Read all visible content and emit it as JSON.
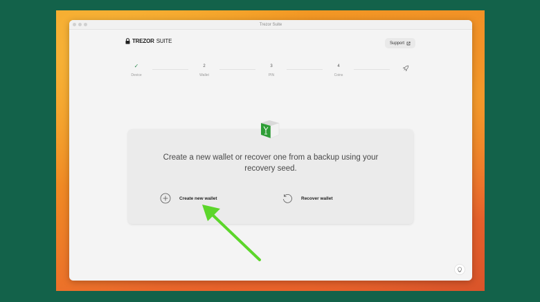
{
  "window": {
    "title": "Trezor Suite"
  },
  "logo": {
    "brand": "TREZOR",
    "product": "SUITE"
  },
  "header": {
    "support_label": "Support"
  },
  "stepper": {
    "steps": [
      {
        "number": "",
        "label": "Device",
        "done": true
      },
      {
        "number": "2",
        "label": "Wallet"
      },
      {
        "number": "3",
        "label": "PIN"
      },
      {
        "number": "4",
        "label": "Coins"
      },
      {
        "number": "",
        "label": "",
        "icon": "rocket-icon"
      }
    ]
  },
  "card": {
    "title": "Create a new wallet or recover one from a backup using your recovery seed.",
    "options": [
      {
        "label": "Create new wallet",
        "icon": "plus-circle-icon"
      },
      {
        "label": "Recover wallet",
        "icon": "restore-icon"
      }
    ]
  },
  "colors": {
    "accent": "#2b8a4e",
    "annotation_arrow": "#5cd62b",
    "desktop_bg": "#13624a"
  }
}
